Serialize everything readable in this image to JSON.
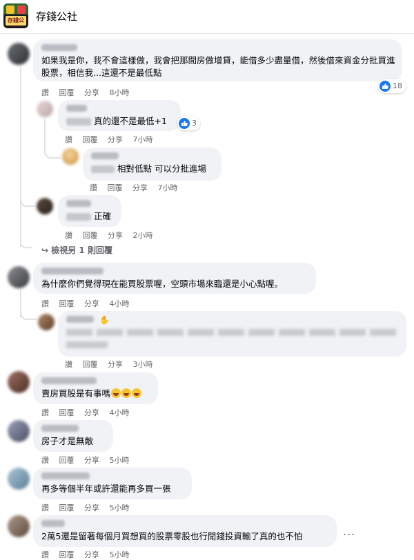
{
  "page": {
    "title": "存錢公社",
    "logo_text": "存錢公社"
  },
  "action_labels": {
    "like": "讚",
    "reply": "回覆",
    "share": "分享"
  },
  "comments": [
    {
      "text": "如果我是你，我不會這樣做，我會把那間房做增貸，能借多少盡量借，然後借來資金分批買進股票，相信我...這還不是最低點",
      "time": "8小時",
      "reactions": "18"
    },
    {
      "text": "真的還不是最低+1",
      "time": "7小時",
      "reactions": "3"
    },
    {
      "text": "相對低點 可以分批進場",
      "time": "7小時"
    },
    {
      "text": "正確",
      "time": "2小時"
    },
    {
      "view_more": "檢視另 1 則回覆"
    },
    {
      "text": "為什麼你們覺得現在能買股票喔，空頭市場來臨還是小心點喔。",
      "time": "4小時"
    },
    {
      "text": "",
      "time": "3小時"
    },
    {
      "text": "賣房買股是有事嗎",
      "time": "4小時"
    },
    {
      "text": "房子才是無敵",
      "time": "5小時"
    },
    {
      "text": "再多等個半年或許還能再多買一張",
      "time": "5小時"
    },
    {
      "text": "2萬5還是留著每個月買想買的股票零股也行閒錢投資輸了真的也不怕",
      "time": "5小時",
      "more": "..."
    }
  ],
  "colors": {
    "like_blue": "#1877f2",
    "bubble_bg": "#f0f2f5",
    "meta_text": "#65676b"
  },
  "icons": [
    "like-icon",
    "reply-arrow-icon",
    "laugh-emoji-icon",
    "more-options-icon"
  ]
}
